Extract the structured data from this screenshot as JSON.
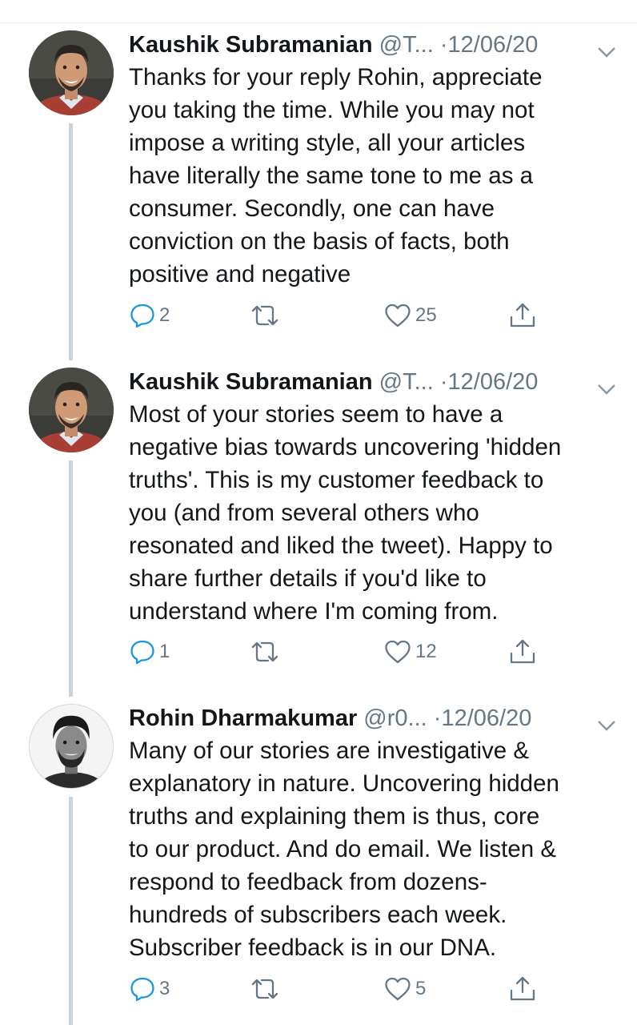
{
  "tweets": [
    {
      "name": "Kaushik Subramanian",
      "handle": "@T...",
      "separator": "·",
      "date": "12/06/20",
      "lines": [
        "Thanks for your reply Rohin, appreciate",
        "you taking the time. While you may not",
        "impose a writing style, all your articles",
        "have literally the same tone to me as a",
        "consumer. Secondly, one can have",
        "conviction on the basis of facts, both",
        "positive and negative"
      ],
      "reply_count": "2",
      "retweet_count": "",
      "like_count": "25",
      "avatar": "kaushik-avatar"
    },
    {
      "name": "Kaushik Subramanian",
      "handle": "@T...",
      "separator": "·",
      "date": "12/06/20",
      "lines": [
        "Most of your stories seem to have a",
        "negative bias towards uncovering 'hidden",
        "truths'. This is my customer feedback to",
        "you (and from several others who",
        "resonated and liked the tweet). Happy to",
        "share further details if you'd like to",
        "understand where I'm coming from."
      ],
      "reply_count": "1",
      "retweet_count": "",
      "like_count": "12",
      "avatar": "kaushik-avatar"
    },
    {
      "name": "Rohin Dharmakumar",
      "handle": "@r0...",
      "separator": "·",
      "date": "12/06/20",
      "lines": [
        "Many of our stories are investigative &",
        "explanatory in nature. Uncovering hidden",
        "truths and explaining them is thus, core",
        "to our product. And do email. We listen &",
        "respond to feedback from dozens-",
        "hundreds of subscribers each week.",
        "Subscriber feedback is in our DNA."
      ],
      "reply_count": "3",
      "retweet_count": "",
      "like_count": "5",
      "avatar": "rohin-avatar"
    }
  ],
  "colors": {
    "text": "#14171a",
    "secondary": "#657786",
    "thread_line": "#c8d3dc",
    "divider": "#e6ecf0"
  },
  "icons": [
    "reply-icon",
    "retweet-icon",
    "like-icon",
    "share-icon",
    "chevron-down-icon"
  ]
}
